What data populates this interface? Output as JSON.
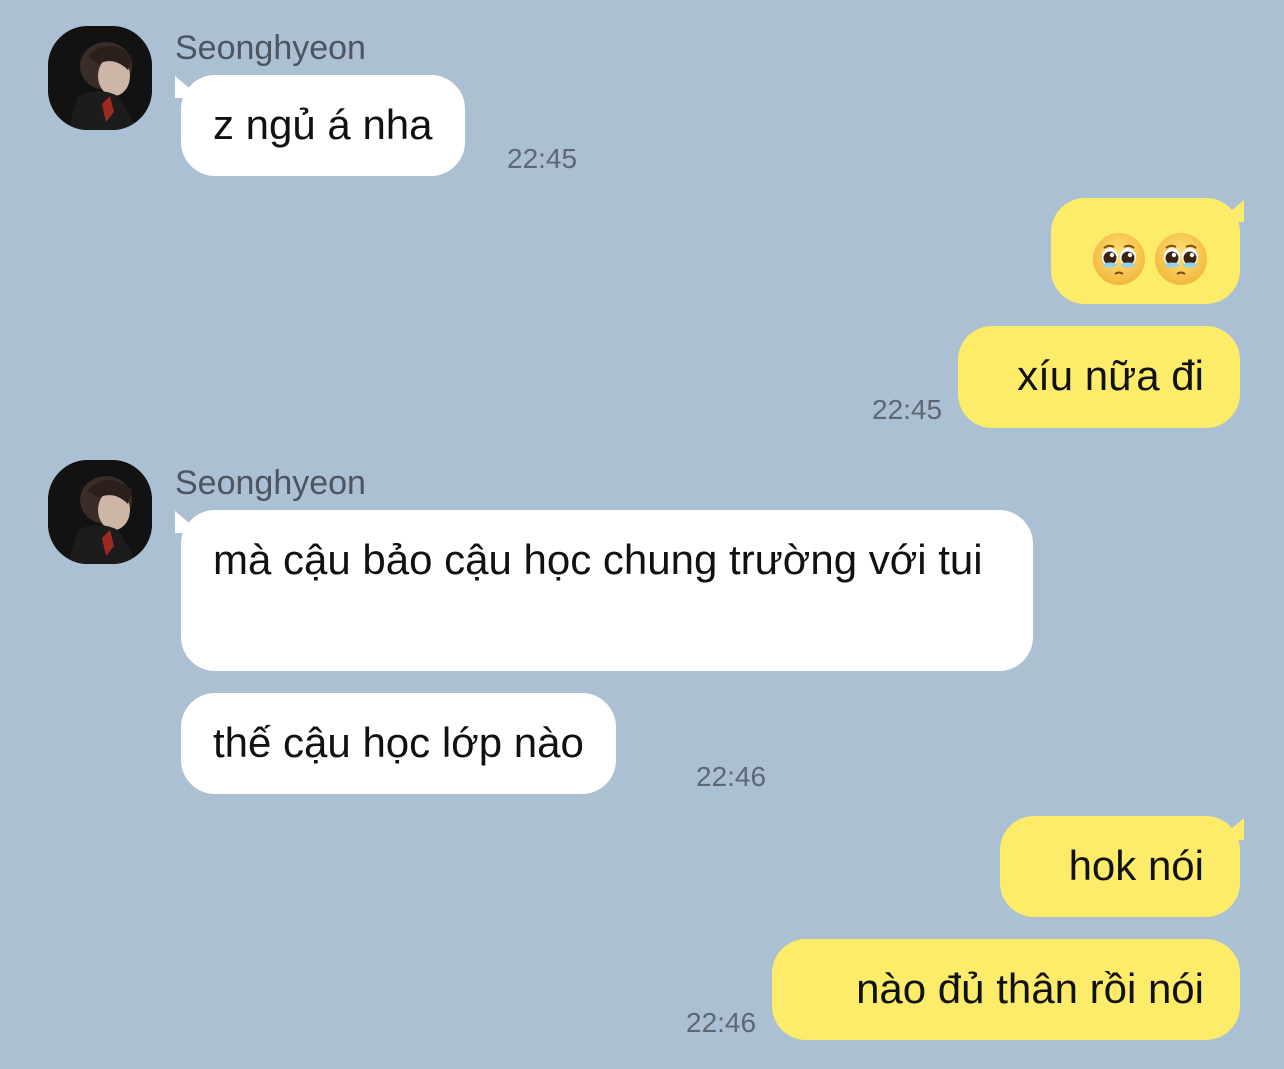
{
  "messages": [
    {
      "sender": "Seonghyeon",
      "text": "z ngủ á nha",
      "time": "22:45"
    },
    {
      "emoji": [
        "pleading-face-emoji",
        "pleading-face-emoji"
      ]
    },
    {
      "text": "xíu nữa đi",
      "time": "22:45"
    },
    {
      "sender": "Seonghyeon",
      "text": "mà cậu bảo cậu học chung trường với tui"
    },
    {
      "text": "thế cậu học lớp nào",
      "time": "22:46"
    },
    {
      "text": "hok nói"
    },
    {
      "text": "nào đủ thân rồi nói",
      "time": "22:46"
    }
  ],
  "colors": {
    "background": "#abc0d2",
    "incoming_bubble": "#ffffff",
    "outgoing_bubble": "#fcec6a",
    "name_text": "#4c5560",
    "time_text": "#5e6873"
  }
}
